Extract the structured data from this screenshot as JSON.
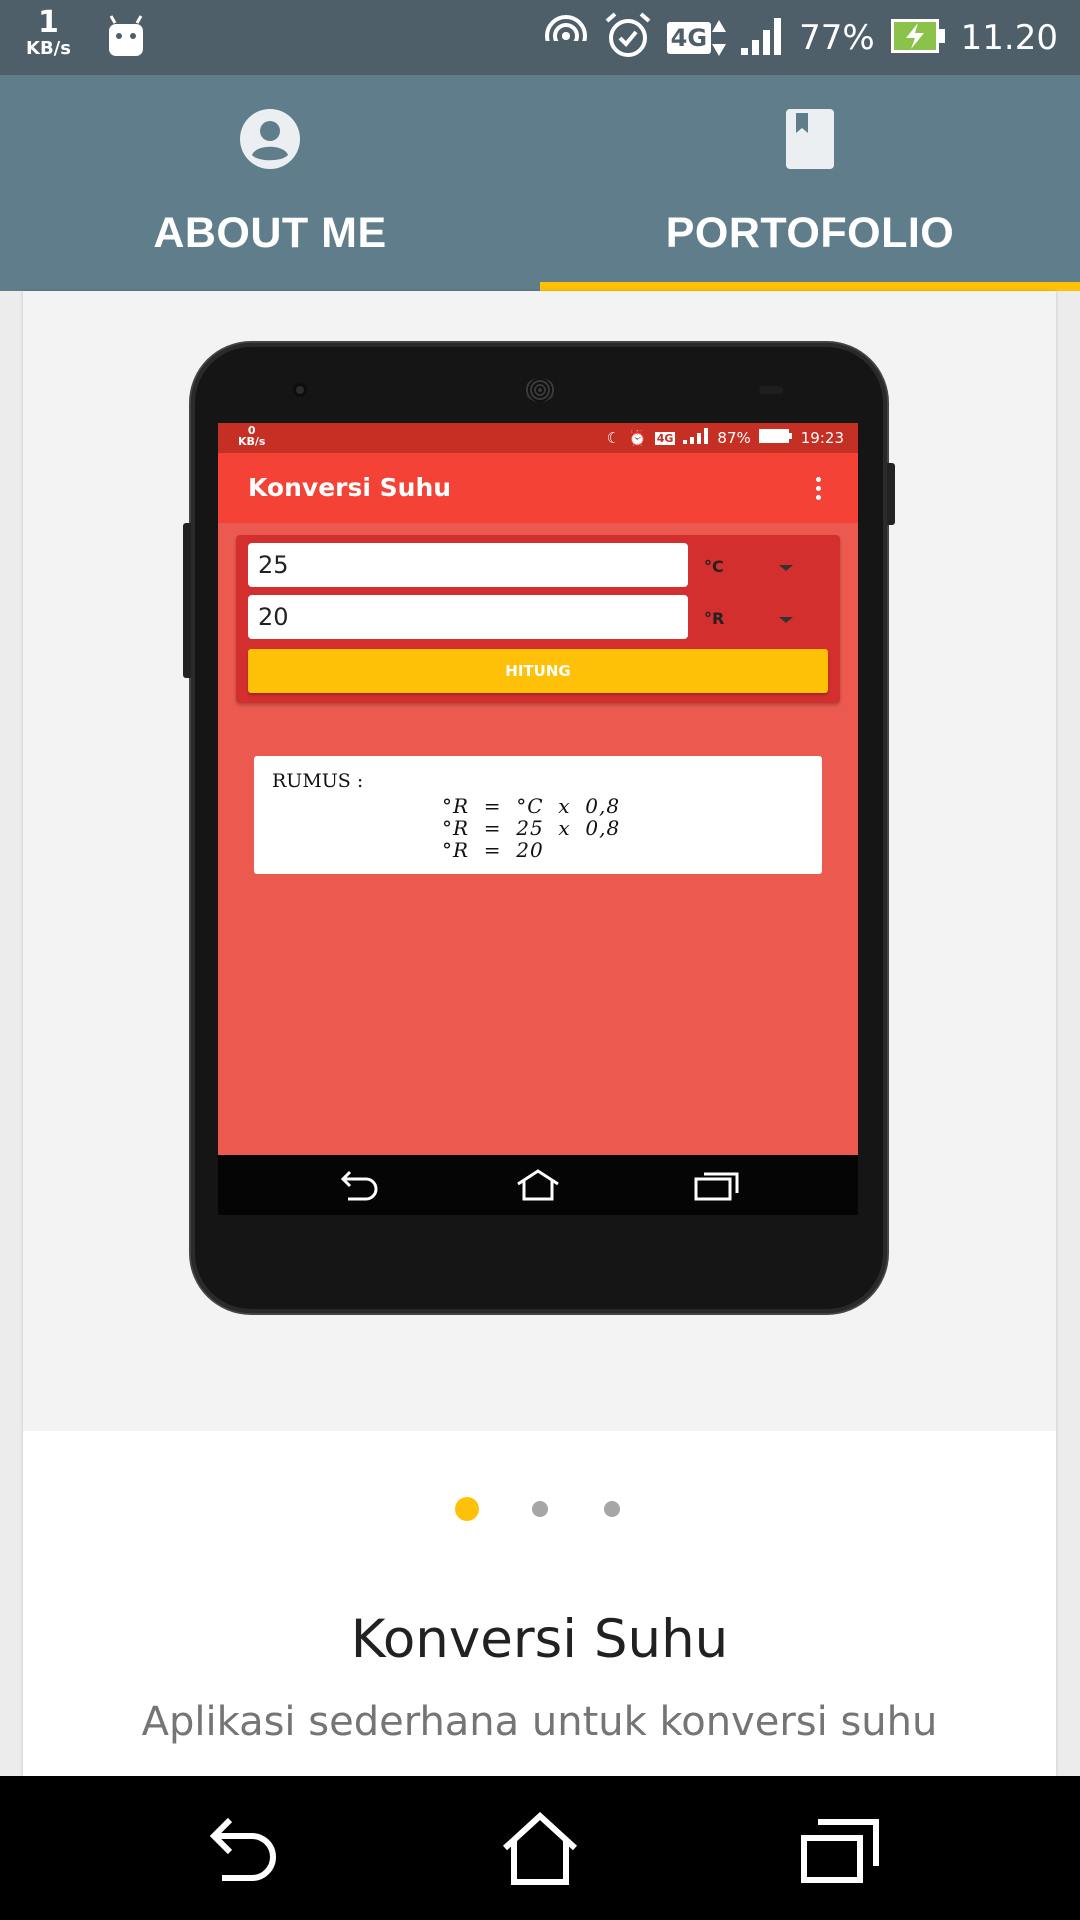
{
  "status_bar": {
    "net_speed_value": "1",
    "net_speed_unit": "KB/s",
    "network": "4G",
    "battery": "77%",
    "time": "11.20",
    "icons": [
      "android-icon",
      "hotspot-icon",
      "alarm-icon",
      "4g-icon",
      "signal-icon",
      "battery-charging-icon"
    ]
  },
  "tabs": [
    {
      "label": "ABOUT ME",
      "icon": "account-circle-icon",
      "selected": false
    },
    {
      "label": "PORTOFOLIO",
      "icon": "book-icon",
      "selected": true
    }
  ],
  "accent_color": "#ffc107",
  "toolbar_color": "#607d8b",
  "portfolio_card": {
    "screenshot": {
      "status": {
        "speed": "0",
        "unit": "KB/s",
        "network": "4G",
        "battery": "87%",
        "time": "19:23"
      },
      "app_title": "Konversi Suhu",
      "input_value": "25",
      "input_unit": "°C",
      "output_value": "20",
      "output_unit": "°R",
      "button_label": "HITUNG",
      "formula_label": "RUMUS :",
      "formula_lines": [
        "°R  =  °C  x  0,8",
        "°R  =  25  x  0,8",
        "°R  =  20"
      ]
    },
    "page_indicator": {
      "count": 3,
      "active": 1
    },
    "title": "Konversi Suhu",
    "description": "Aplikasi sederhana untuk konversi suhu"
  },
  "nav_bar": {
    "buttons": [
      "back-icon",
      "home-icon",
      "recent-apps-icon"
    ]
  }
}
